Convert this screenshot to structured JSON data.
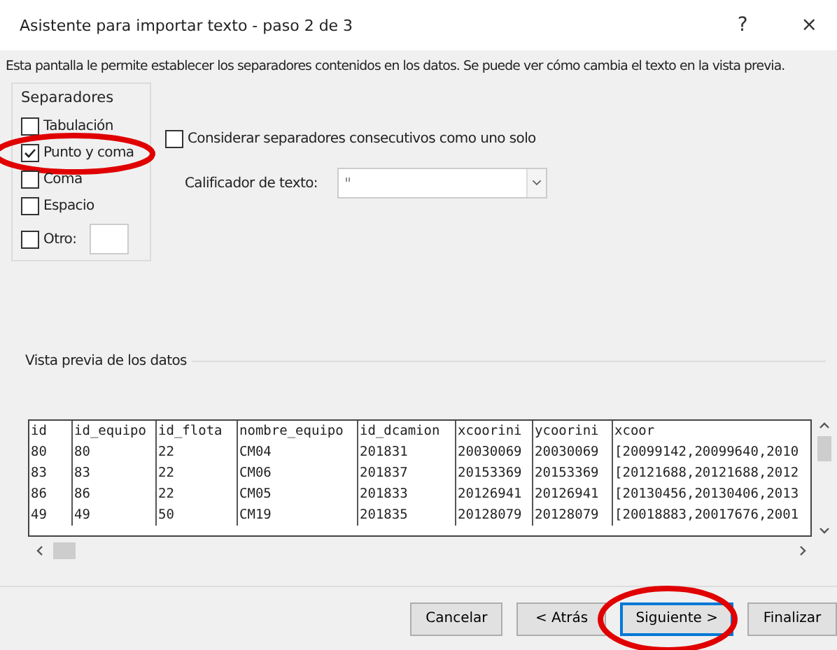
{
  "window": {
    "title": "Asistente para importar texto - paso 2 de 3",
    "help": "?",
    "close": "×"
  },
  "description": "Esta pantalla le permite establecer los separadores contenidos en los datos. Se puede ver cómo cambia el texto en la vista previa.",
  "separators": {
    "title": "Separadores",
    "items": [
      {
        "label": "Tabulación",
        "checked": false,
        "circled": false
      },
      {
        "label": "Punto y coma",
        "checked": true,
        "circled": true
      },
      {
        "label": "Coma",
        "checked": false,
        "circled": false
      },
      {
        "label": "Espacio",
        "checked": false,
        "circled": false
      },
      {
        "label": "Otro:",
        "checked": false,
        "circled": false,
        "kind": "other"
      }
    ]
  },
  "consecutive": {
    "label": "Considerar separadores consecutivos como uno solo",
    "checked": false
  },
  "qualifier": {
    "label": "Calificador de texto:",
    "value": "\""
  },
  "preview": {
    "title": "Vista previa de los datos",
    "columns": [
      "id",
      "id_equipo",
      "id_flota",
      "nombre_equipo",
      "id_dcamion",
      "xcoorini",
      "ycoorini",
      "xcoor"
    ],
    "rows": [
      [
        "80",
        "80",
        "22",
        "CM04",
        "201831",
        "20030069",
        "20030069",
        "[20099142,20099640,2010"
      ],
      [
        "83",
        "83",
        "22",
        "CM06",
        "201837",
        "20153369",
        "20153369",
        "[20121688,20121688,2012"
      ],
      [
        "86",
        "86",
        "22",
        "CM05",
        "201833",
        "20126941",
        "20126941",
        "[20130456,20130406,2013"
      ],
      [
        "49",
        "49",
        "50",
        "CM19",
        "201835",
        "20128079",
        "20128079",
        "[20018883,20017676,2001"
      ]
    ]
  },
  "buttons": [
    {
      "label": "Cancelar",
      "default": false,
      "circled": false
    },
    {
      "label": "< Atrás",
      "default": false,
      "circled": false
    },
    {
      "label": "Siguiente >",
      "default": true,
      "circled": true
    },
    {
      "label": "Finalizar",
      "default": false,
      "circled": false
    }
  ]
}
